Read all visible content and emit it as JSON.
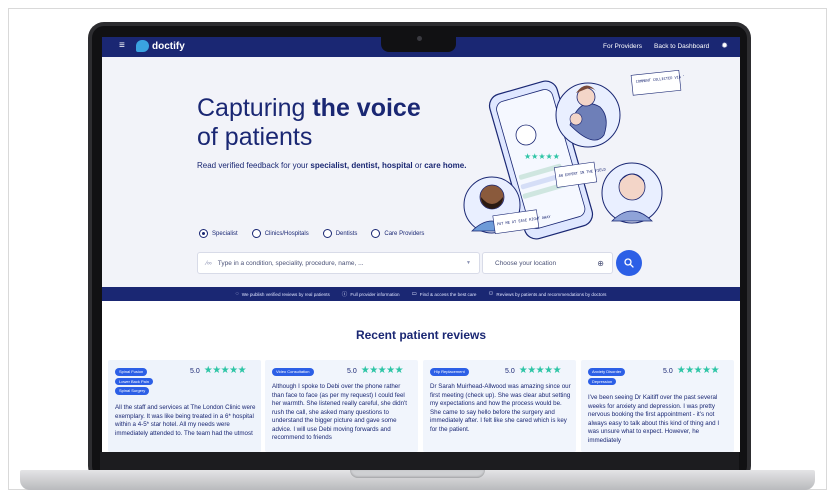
{
  "nav": {
    "logo_text": "doctify",
    "links": [
      "For Providers",
      "Back to Dashboard"
    ]
  },
  "hero": {
    "title_plain_1": "Capturing ",
    "title_bold": "the voice",
    "title_plain_2": "of patients",
    "sub_plain_1": "Read verified feedback for your ",
    "sub_bold_1": "specialist, dentist, hospital",
    "sub_plain_2": " or ",
    "sub_bold_2": "care home."
  },
  "illustration_notes": {
    "note_1": "COMMENT COLLECTED VIA TEXT",
    "note_2": "AN EXPERT IN THE FIELD",
    "note_3": "PUT ME AT EASE RIGHT AWAY"
  },
  "search": {
    "provider_types": [
      {
        "label": "Specialist",
        "selected": true
      },
      {
        "label": "Clinics/Hospitals",
        "selected": false
      },
      {
        "label": "Dentists",
        "selected": false
      },
      {
        "label": "Care Providers",
        "selected": false
      }
    ],
    "query_placeholder": "Type in a condition, speciality, procedure, name, ...",
    "location_placeholder": "Choose your location"
  },
  "info_bar": [
    "We publish verified reviews by real patients",
    "Full provider information",
    "Find & access the best care",
    "Reviews by patients and recommendations by doctors"
  ],
  "reviews": {
    "title": "Recent patient reviews",
    "items": [
      {
        "badges": [
          "Spinal Fusion",
          "Lower Back Pain",
          "Spinal Surgery"
        ],
        "rating": "5.0",
        "text": "All the staff and services at The London Clinic were exemplary. It was like being treated in a 6* hospital within a 4-5* star hotel. All my needs were immediately attended to. The team had the utmost"
      },
      {
        "badges": [
          "Video Consultation"
        ],
        "rating": "5.0",
        "text": "Although I spoke to Debi over the phone rather than face to face (as per my request) I could feel her warmth. She listened really careful, she didn't rush the call, she asked many questions to understand the bigger picture and gave some advice. I will use Debi moving forwards and recommend to friends"
      },
      {
        "badges": [
          "Hip Replacement"
        ],
        "rating": "5.0",
        "text": "Dr Sarah Muirhead-Allwood was amazing since our first meeting (check up). She was clear abut setting my expectations and how the process would be. She came to say hello before the surgery and immediately after. I felt like she cared which is key for the patient."
      },
      {
        "badges": [
          "Anxiety Disorder",
          "Depression"
        ],
        "rating": "5.0",
        "text": "I've been seeing Dr Kaitiff over the past several weeks for anxiety and depression. I was pretty nervous booking the first appointment - it's not always easy to talk about this kind of thing and I was unsure what to expect. However, he immediately"
      }
    ]
  },
  "colors": {
    "navy": "#1a2773",
    "accent_blue": "#2c5fe6",
    "star_teal": "#2ec5a6"
  }
}
